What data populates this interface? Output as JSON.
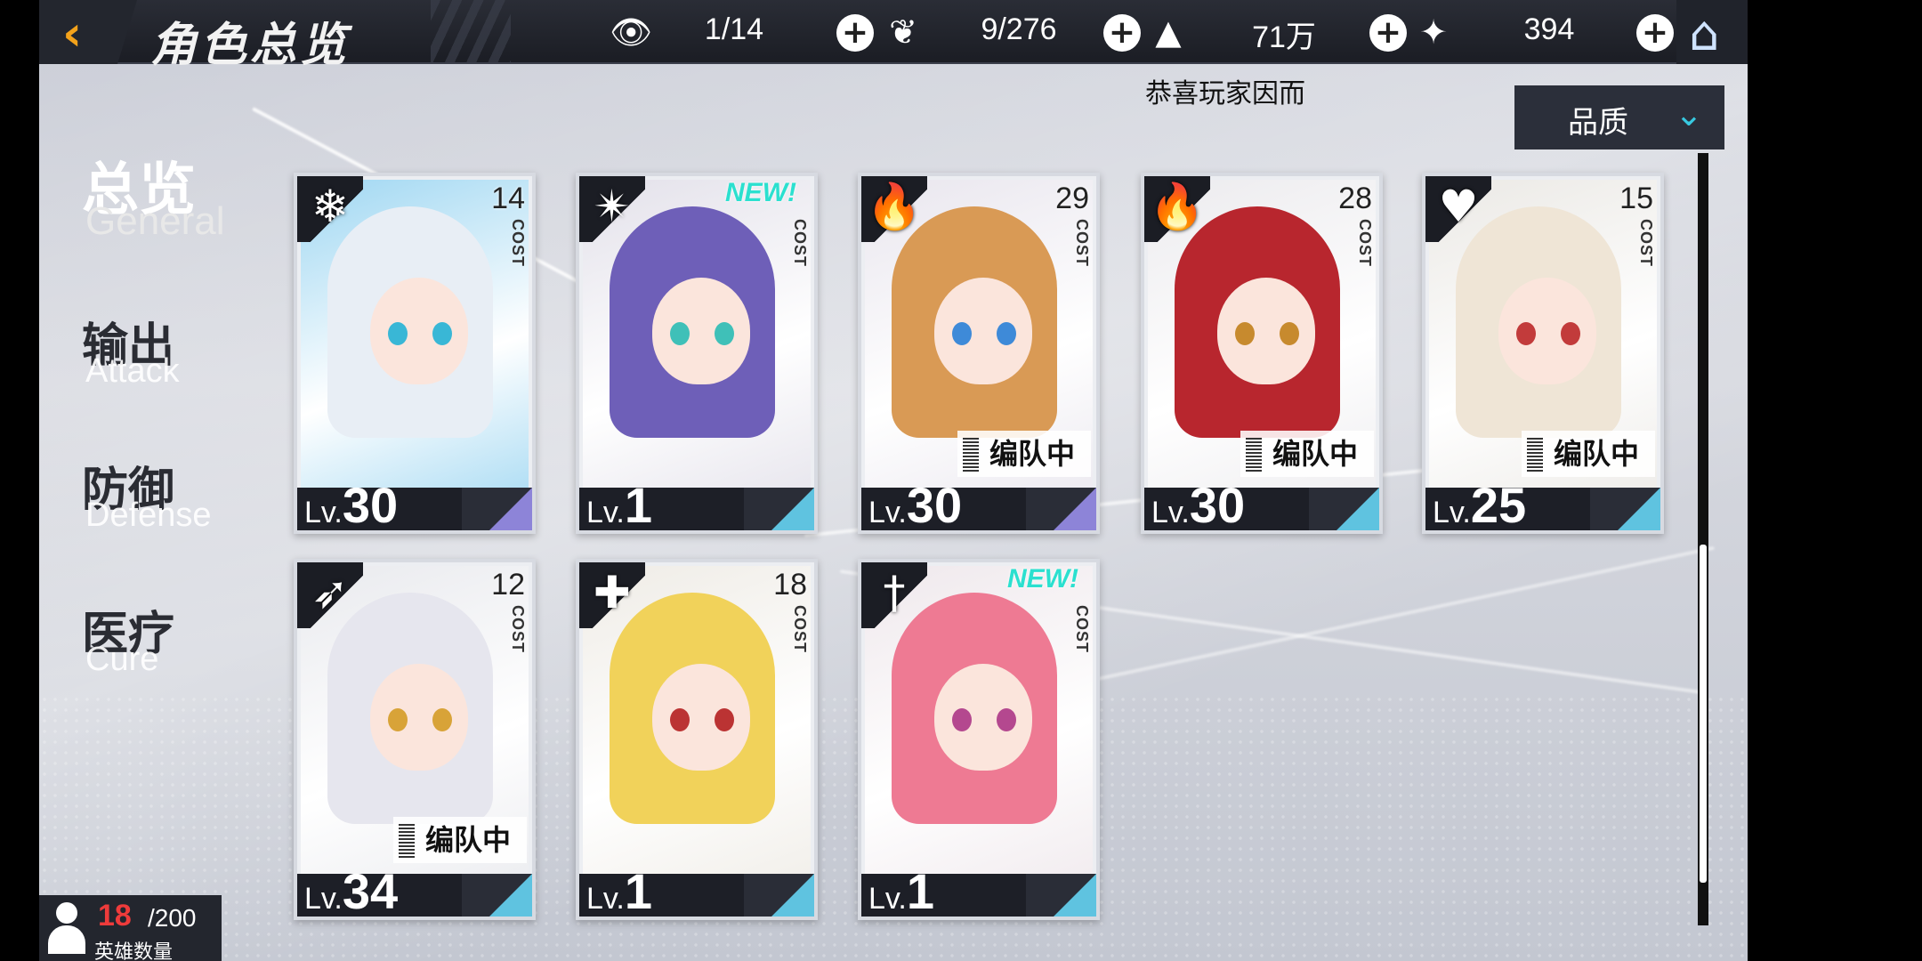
{
  "header": {
    "back_icon": "chevron-left-icon",
    "title": "角色总览",
    "resources": [
      {
        "icon": "eye-icon",
        "value": "1/14"
      },
      {
        "icon": "heart-crystal-icon",
        "value": "9/276"
      },
      {
        "icon": "gold-triangle-icon",
        "value": "71万"
      },
      {
        "icon": "star-crystal-icon",
        "value": "394"
      }
    ],
    "plus": "+",
    "home_icon": "home-icon"
  },
  "notice": "恭喜玩家因而",
  "sort": {
    "label": "品质",
    "icon": "chevron-down-icon"
  },
  "tabs": [
    {
      "zh": "总览",
      "en": "General"
    },
    {
      "zh": "输出",
      "en": "Attack"
    },
    {
      "zh": "防御",
      "en": "Defense"
    },
    {
      "zh": "医疗",
      "en": "Cure"
    }
  ],
  "cards": [
    {
      "cost": "14",
      "cost_label": "COST",
      "element_icon": "ice-flower-icon",
      "element_glyph": "❄",
      "lv_prefix": "Lv.",
      "level": "30",
      "new": "",
      "team": "",
      "hair": "#e8eef5",
      "eyes": "#39b7d6",
      "bg": "#9fd7f2",
      "accent": "#8d84d8"
    },
    {
      "cost": "",
      "cost_label": "COST",
      "element_icon": "shuriken-icon",
      "element_glyph": "✴",
      "lv_prefix": "Lv.",
      "level": "1",
      "new": "NEW!",
      "team": "",
      "hair": "#6e5fb8",
      "eyes": "#3fc0b8",
      "bg": "#e3e1ea",
      "accent": "#5fc3e0"
    },
    {
      "cost": "29",
      "cost_label": "COST",
      "element_icon": "fire-icon",
      "element_glyph": "🔥",
      "lv_prefix": "Lv.",
      "level": "30",
      "new": "",
      "team": "编队中",
      "hair": "#d99a55",
      "eyes": "#3e8ad8",
      "bg": "#e9e6ee",
      "accent": "#8d84d8"
    },
    {
      "cost": "28",
      "cost_label": "COST",
      "element_icon": "fire-icon",
      "element_glyph": "🔥",
      "lv_prefix": "Lv.",
      "level": "30",
      "new": "",
      "team": "编队中",
      "hair": "#b8262e",
      "eyes": "#c78a2e",
      "bg": "#ecebee",
      "accent": "#5fc3e0"
    },
    {
      "cost": "15",
      "cost_label": "COST",
      "element_icon": "heart-icon",
      "element_glyph": "♥",
      "lv_prefix": "Lv.",
      "level": "25",
      "new": "",
      "team": "编队中",
      "hair": "#efe5d6",
      "eyes": "#c23b3b",
      "bg": "#ebe9e5",
      "accent": "#5fc3e0"
    },
    {
      "cost": "12",
      "cost_label": "COST",
      "element_icon": "bow-icon",
      "element_glyph": "➶",
      "lv_prefix": "Lv.",
      "level": "34",
      "new": "",
      "team": "编队中",
      "hair": "#e6e6ee",
      "eyes": "#d8a338",
      "bg": "#e9eaee",
      "accent": "#5fc3e0"
    },
    {
      "cost": "18",
      "cost_label": "COST",
      "element_icon": "shield-cross-icon",
      "element_glyph": "✚",
      "lv_prefix": "Lv.",
      "level": "1",
      "new": "",
      "team": "",
      "hair": "#f1d25a",
      "eyes": "#b33",
      "bg": "#efece6",
      "accent": "#5fc3e0"
    },
    {
      "cost": "",
      "cost_label": "COST",
      "element_icon": "sword-icon",
      "element_glyph": "†",
      "lv_prefix": "Lv.",
      "level": "1",
      "new": "NEW!",
      "team": "",
      "hair": "#ee7a93",
      "eyes": "#b4488f",
      "bg": "#efe8ec",
      "accent": "#5fc3e0"
    }
  ],
  "hero_count": {
    "current": "18",
    "max": "/200",
    "label": "英雄数量",
    "icon": "person-icon"
  }
}
